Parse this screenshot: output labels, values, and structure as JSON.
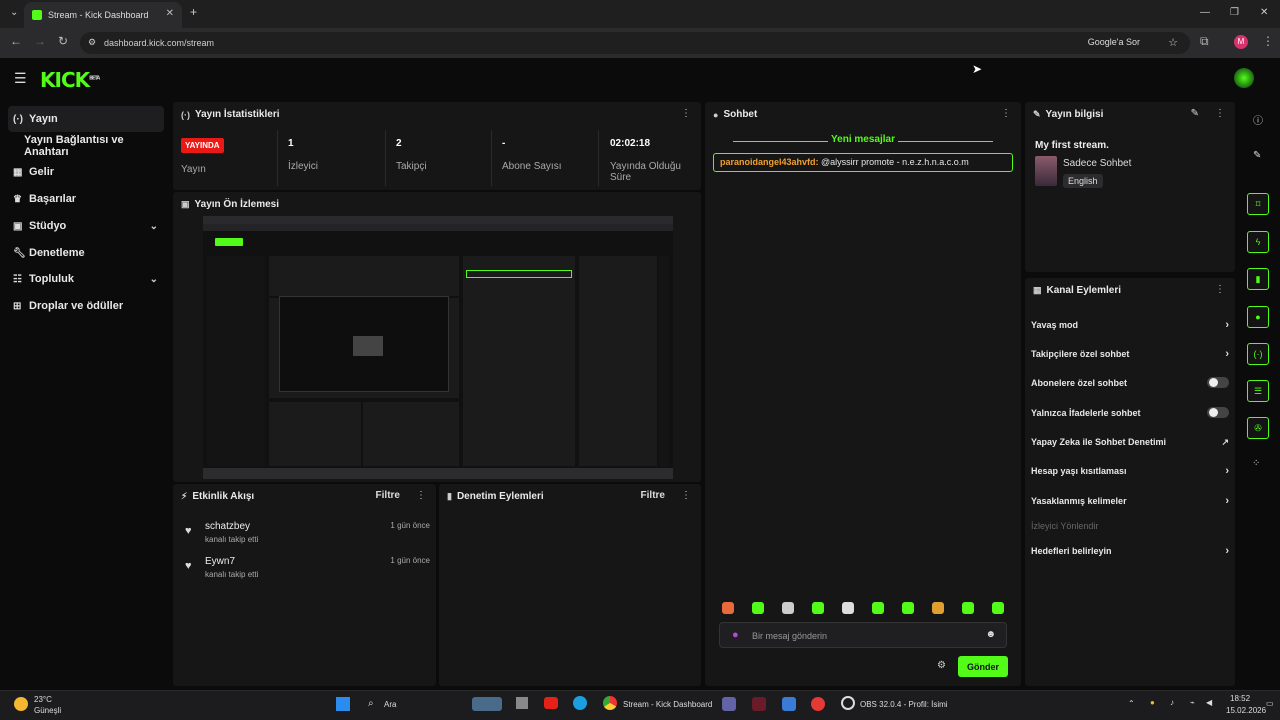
{
  "browser": {
    "tab_title": "Stream - Kick Dashboard",
    "url": "dashboard.kick.com/stream",
    "google_label": "Google'a Sor",
    "profile_initial": "M"
  },
  "app": {
    "logo": "KICK",
    "logo_badge": "BETA"
  },
  "sidebar": {
    "items": [
      {
        "label": "Yayın",
        "icon": "broadcast-icon"
      },
      {
        "label": "Yayın Bağlantısı ve Anahtarı",
        "icon": ""
      },
      {
        "label": "Gelir",
        "icon": "chart-icon"
      },
      {
        "label": "Başarılar",
        "icon": "trophy-icon"
      },
      {
        "label": "Stüdyo",
        "icon": "studio-icon"
      },
      {
        "label": "Denetleme",
        "icon": "wrench-icon"
      },
      {
        "label": "Topluluk",
        "icon": "community-icon"
      },
      {
        "label": "Droplar ve ödüller",
        "icon": "gift-icon"
      }
    ]
  },
  "stats": {
    "title": "Yayın İstatistikleri",
    "live_badge": "YAYINDA",
    "live_label": "Yayın",
    "viewers_value": "1",
    "viewers_label": "İzleyici",
    "followers_value": "2",
    "followers_label": "Takipçi",
    "subs_value": "-",
    "subs_label": "Abone Sayısı",
    "duration_value": "02:02:18",
    "duration_label": "Yayında Olduğu Süre"
  },
  "preview": {
    "title": "Yayın Ön İzlemesi"
  },
  "activity": {
    "title": "Etkinlik Akışı",
    "filter": "Filtre",
    "rows": [
      {
        "name": "schatzbey",
        "sub": "kanalı takip etti",
        "time": "1 gün önce"
      },
      {
        "name": "Eywn7",
        "sub": "kanalı takip etti",
        "time": "1 gün önce"
      }
    ]
  },
  "moderation": {
    "title": "Denetim Eylemleri",
    "filter": "Filtre"
  },
  "chat": {
    "title": "Sohbet",
    "new_messages": "Yeni mesajlar",
    "message_user": "paranoidangel43ahvfd:",
    "message_text": " @alyssirr promote - n.e.z.h.n.a.c.o.m",
    "input_placeholder": "Bir mesaj gönderin",
    "send": "Gönder"
  },
  "stream_info": {
    "title": "Yayın bilgisi",
    "stream_title": "My first stream.",
    "category": "Sadece Sohbet",
    "language": "English"
  },
  "channel_actions": {
    "title": "Kanal Eylemleri",
    "rows": [
      {
        "label": "Yavaş mod",
        "kind": "chevron"
      },
      {
        "label": "Takipçilere özel sohbet",
        "kind": "chevron"
      },
      {
        "label": "Abonelere özel sohbet",
        "kind": "toggle"
      },
      {
        "label": "Yalnızca İfadelerle sohbet",
        "kind": "toggle"
      },
      {
        "label": "Yapay Zeka ile Sohbet Denetimi",
        "kind": "external"
      },
      {
        "label": "Hesap yaşı kısıtlaması",
        "kind": "chevron"
      },
      {
        "label": "Yasaklanmış kelimeler",
        "kind": "chevron"
      },
      {
        "label": "İzleyici Yönlendir",
        "kind": "disabled"
      },
      {
        "label": "Hedefleri belirleyin",
        "kind": "chevron"
      }
    ]
  },
  "taskbar": {
    "weather_temp": "23°C",
    "weather_desc": "Güneşli",
    "search": "Ara",
    "chrome_task": "Stream - Kick Dashboard",
    "obs_task": "OBS 32.0.4 - Profil: İsimi",
    "time": "18:52",
    "date": "15.02.2026"
  },
  "colors": {
    "accent": "#53fc18",
    "live": "#e91916",
    "panel": "#161617",
    "bg": "#0b0b0c"
  }
}
